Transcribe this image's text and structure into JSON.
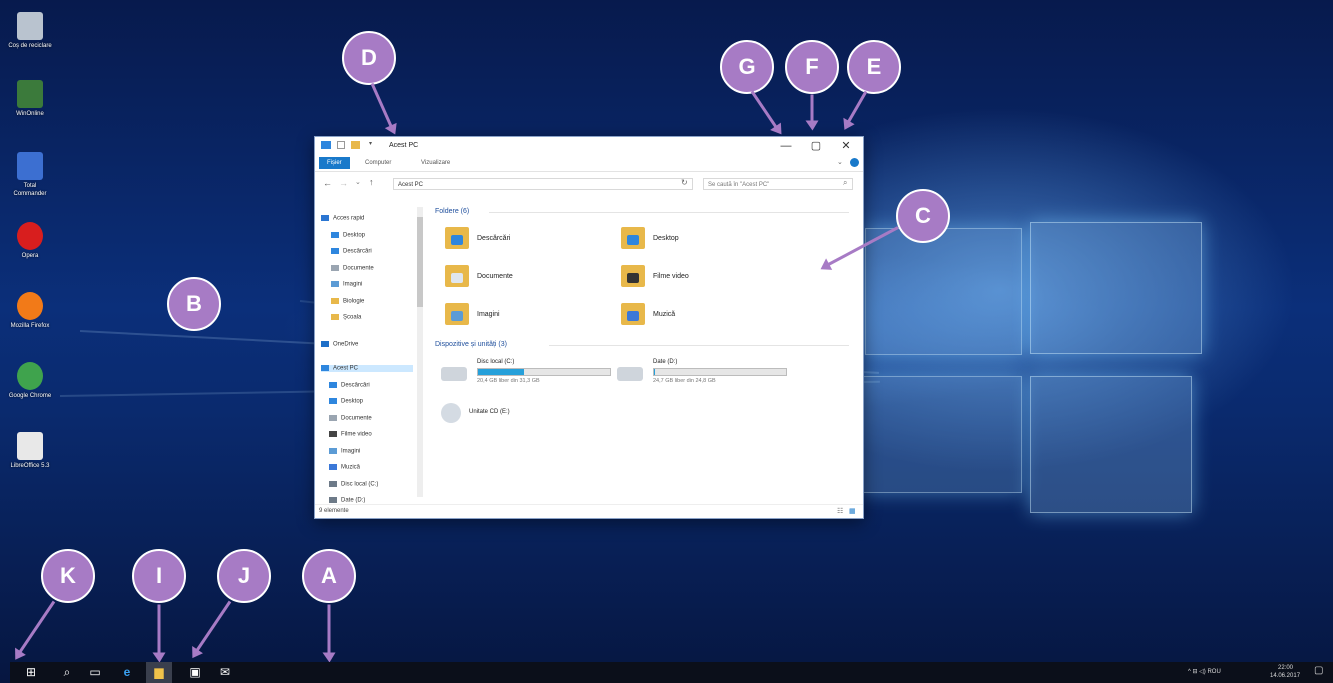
{
  "desktop": {
    "icons": [
      {
        "name": "recycle-bin",
        "label": "Coș de reciclare",
        "color": "#b9c3cf"
      },
      {
        "name": "winrar",
        "label": "WinOnline",
        "color": "#3b7a3b"
      },
      {
        "name": "total-commander",
        "label": "Total Commander",
        "color": "#3c6fd1"
      },
      {
        "name": "opera",
        "label": "Opera",
        "color": "#d81e1e"
      },
      {
        "name": "firefox",
        "label": "Mozilla Firefox",
        "color": "#f27a18"
      },
      {
        "name": "chrome",
        "label": "Google Chrome",
        "color": "#3fa34d"
      },
      {
        "name": "libreoffice",
        "label": "LibreOffice 5.3",
        "color": "#e8e8e8"
      }
    ]
  },
  "callouts": {
    "A": "A",
    "B": "B",
    "C": "C",
    "D": "D",
    "E": "E",
    "F": "F",
    "G": "G",
    "I": "I",
    "J": "J",
    "K": "K"
  },
  "explorer": {
    "title": "Acest PC",
    "minimize_glyph": "—",
    "maximize_glyph": "▢",
    "close_glyph": "✕",
    "ribbon_tabs": [
      "Fișier",
      "Computer",
      "Vizualizare"
    ],
    "address": "Acest PC",
    "search_placeholder": "Se caută în \"Acest PC\"",
    "nav": [
      {
        "label": "Acces rapid",
        "icon": "star-icon",
        "color": "#2b76d2"
      },
      {
        "label": "Desktop",
        "icon": "desktop-icon",
        "color": "#2e86de"
      },
      {
        "label": "Descărcări",
        "icon": "download-icon",
        "color": "#2e86de"
      },
      {
        "label": "Documente",
        "icon": "document-icon",
        "color": "#9aa5b1"
      },
      {
        "label": "Imagini",
        "icon": "image-icon",
        "color": "#5b9bd5"
      },
      {
        "label": "Biologie",
        "icon": "folder-icon",
        "color": "#e8b84a"
      },
      {
        "label": "Școala",
        "icon": "folder-icon",
        "color": "#e8b84a"
      },
      {
        "label": "OneDrive",
        "icon": "cloud-icon",
        "color": "#1e6fc8"
      },
      {
        "label": "Acest PC",
        "icon": "pc-icon",
        "color": "#2e86de"
      },
      {
        "label": "Descărcări",
        "icon": "download-icon",
        "color": "#2e86de"
      },
      {
        "label": "Desktop",
        "icon": "desktop-icon",
        "color": "#2e86de"
      },
      {
        "label": "Documente",
        "icon": "document-icon",
        "color": "#9aa5b1"
      },
      {
        "label": "Filme video",
        "icon": "video-icon",
        "color": "#444"
      },
      {
        "label": "Imagini",
        "icon": "image-icon",
        "color": "#5b9bd5"
      },
      {
        "label": "Muzică",
        "icon": "music-icon",
        "color": "#3b78d8"
      },
      {
        "label": "Disc local (C:)",
        "icon": "drive-icon",
        "color": "#6d7a88"
      },
      {
        "label": "Date (D:)",
        "icon": "drive-icon",
        "color": "#6d7a88"
      }
    ],
    "folders_header": "Foldere (6)",
    "folders": [
      {
        "label": "Descărcări",
        "badge": "#2e86de"
      },
      {
        "label": "Desktop",
        "badge": "#2e86de"
      },
      {
        "label": "Documente",
        "badge": "#dfe6ee"
      },
      {
        "label": "Filme video",
        "badge": "#333"
      },
      {
        "label": "Imagini",
        "badge": "#5b9bd5"
      },
      {
        "label": "Muzică",
        "badge": "#3b78d8"
      }
    ],
    "drives_header": "Dispozitive și unități (3)",
    "drives": [
      {
        "label": "Disc local (C:)",
        "free": "20,4 GB liber din 31,3 GB",
        "used_fraction": 0.35
      },
      {
        "label": "Date (D:)",
        "free": "24,7 GB liber din 24,8 GB",
        "used_fraction": 0.01
      }
    ],
    "cd_drive": "Unitate CD (E:)",
    "status": "9 elemente"
  },
  "taskbar": {
    "items": [
      {
        "name": "start-button",
        "glyph": "⊞"
      },
      {
        "name": "search-button",
        "glyph": "⌕"
      },
      {
        "name": "task-view-button",
        "glyph": "▭"
      },
      {
        "name": "edge-button",
        "glyph": "e"
      },
      {
        "name": "file-explorer-button",
        "glyph": "▆"
      },
      {
        "name": "store-button",
        "glyph": "▣"
      },
      {
        "name": "mail-button",
        "glyph": "✉"
      }
    ],
    "tray_icons": "^ ⊟ ◁) ROU",
    "time": "22:00",
    "date": "14.06.2017",
    "notification_glyph": "▢"
  }
}
